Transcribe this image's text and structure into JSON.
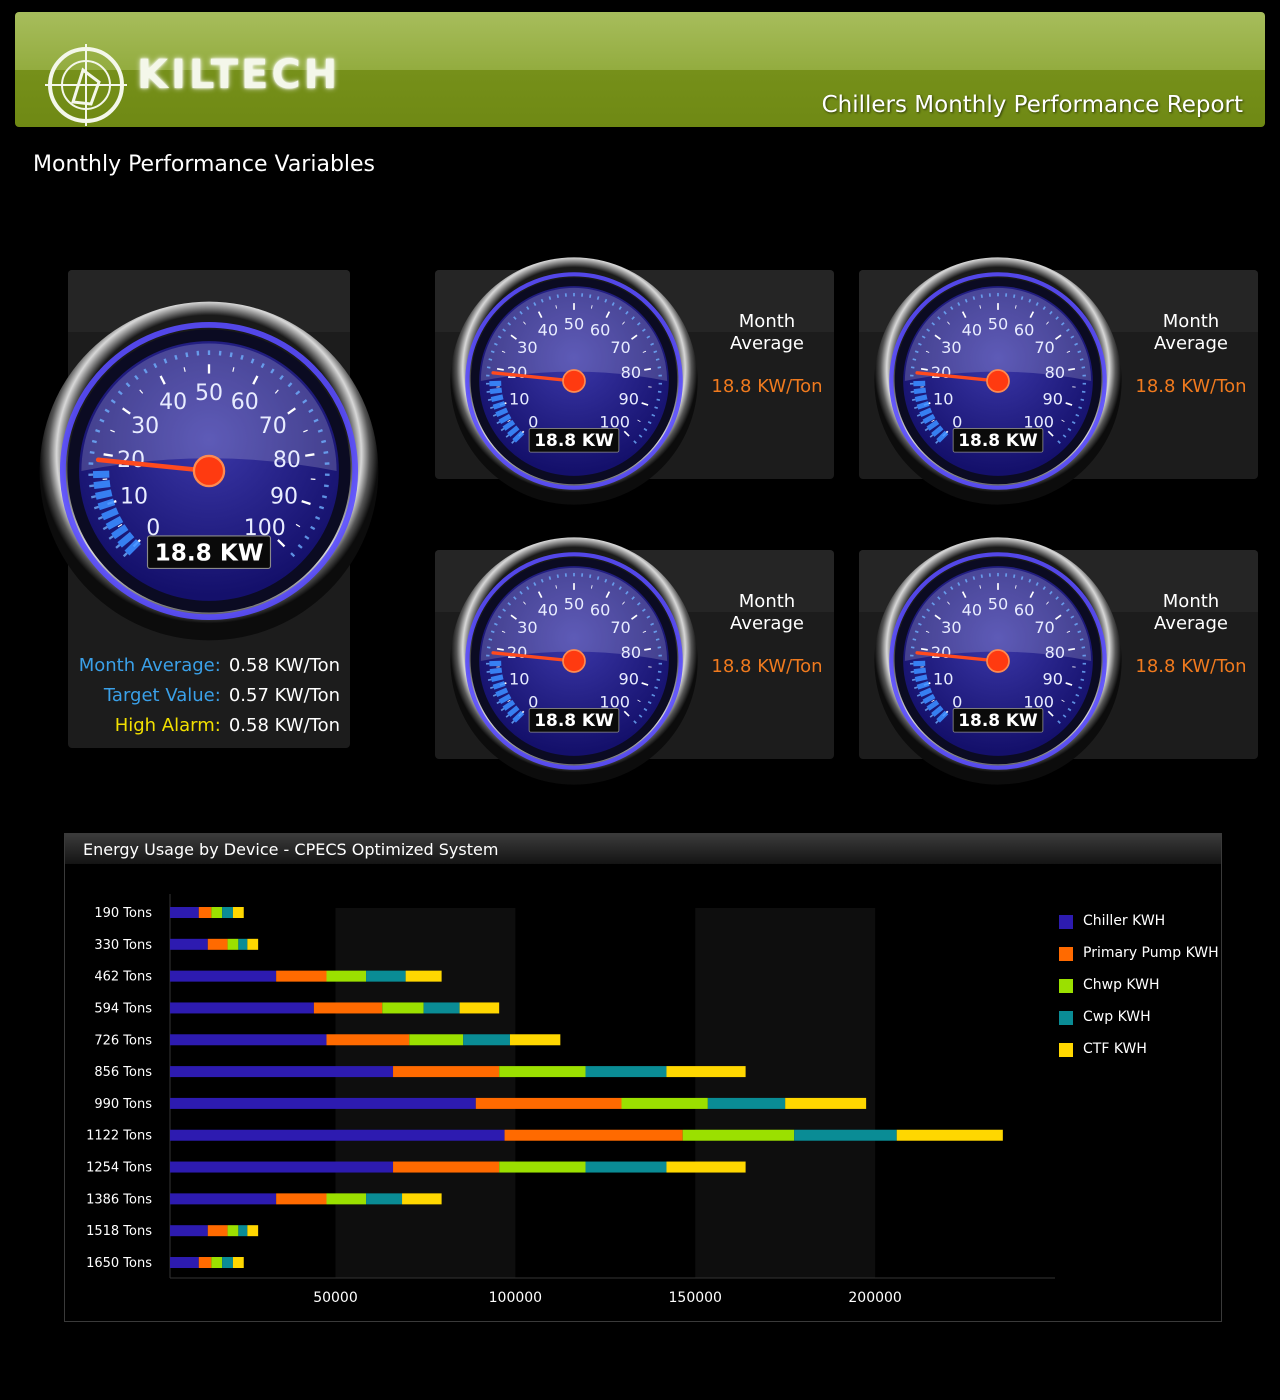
{
  "header": {
    "brand": "KILTECH",
    "report_title": "Chillers Monthly Performance Report"
  },
  "section_title": "Monthly Performance Variables",
  "gauge_scale": {
    "min": 0,
    "max": 100,
    "ticks": [
      "0",
      "10",
      "20",
      "30",
      "40",
      "50",
      "60",
      "70",
      "80",
      "90",
      "100"
    ]
  },
  "main_gauge": {
    "value": 18.8,
    "readout": "18.8 KW",
    "stats": [
      {
        "label": "Month Average:",
        "value": "0.58 KW/Ton",
        "color": "#3aa0e8"
      },
      {
        "label": "Target Value:",
        "value": "0.57 KW/Ton",
        "color": "#3aa0e8"
      },
      {
        "label": "High Alarm:",
        "value": "0.58 KW/Ton",
        "color": "#f2e000"
      }
    ]
  },
  "small_gauges": [
    {
      "value": 18.8,
      "readout": "18.8 KW",
      "label_line1": "Month",
      "label_line2": "Average",
      "metric": "18.8 KW/Ton"
    },
    {
      "value": 18.8,
      "readout": "18.8 KW",
      "label_line1": "Month",
      "label_line2": "Average",
      "metric": "18.8 KW/Ton"
    },
    {
      "value": 18.8,
      "readout": "18.8 KW",
      "label_line1": "Month",
      "label_line2": "Average",
      "metric": "18.8 KW/Ton"
    },
    {
      "value": 18.8,
      "readout": "18.8 KW",
      "label_line1": "Month",
      "label_line2": "Average",
      "metric": "18.8 KW/Ton"
    }
  ],
  "chart_data": {
    "type": "bar",
    "orientation": "horizontal",
    "stacked": true,
    "title": "Energy Usage by Device - CPECS Optimized System",
    "categories": [
      "190 Tons",
      "330 Tons",
      "462 Tons",
      "594 Tons",
      "726 Tons",
      "856 Tons",
      "990 Tons",
      "1122 Tons",
      "1254 Tons",
      "1386 Tons",
      "1518 Tons",
      "1650 Tons"
    ],
    "x_ticks": [
      50000,
      100000,
      150000,
      200000
    ],
    "x_tick_labels": [
      "50000",
      "100000",
      "150000",
      "200000"
    ],
    "xlim": [
      4000,
      250000
    ],
    "legend_position": "right",
    "series": [
      {
        "name": "Chiller KWH",
        "color": "#2d1bb0",
        "values": [
          8000,
          10500,
          29500,
          40000,
          43500,
          62000,
          85000,
          93000,
          62000,
          29500,
          10500,
          8000
        ]
      },
      {
        "name": "Primary Pump KWH",
        "color": "#ff6a00",
        "values": [
          3500,
          5500,
          14000,
          19000,
          23000,
          29500,
          40500,
          49500,
          29500,
          14000,
          5500,
          3500
        ]
      },
      {
        "name": "Chwp KWH",
        "color": "#9be000",
        "values": [
          3000,
          3000,
          11000,
          11500,
          15000,
          24000,
          24000,
          31000,
          24000,
          11000,
          3000,
          3000
        ]
      },
      {
        "name": "Cwp KWH",
        "color": "#0a8c95",
        "values": [
          3000,
          2500,
          11000,
          10000,
          13000,
          22500,
          21500,
          28500,
          22500,
          10000,
          2500,
          3000
        ]
      },
      {
        "name": "CTF KWH",
        "color": "#ffd700",
        "values": [
          3000,
          3000,
          10000,
          11000,
          14000,
          22000,
          22500,
          29500,
          22000,
          11000,
          3000,
          3000
        ]
      }
    ]
  }
}
